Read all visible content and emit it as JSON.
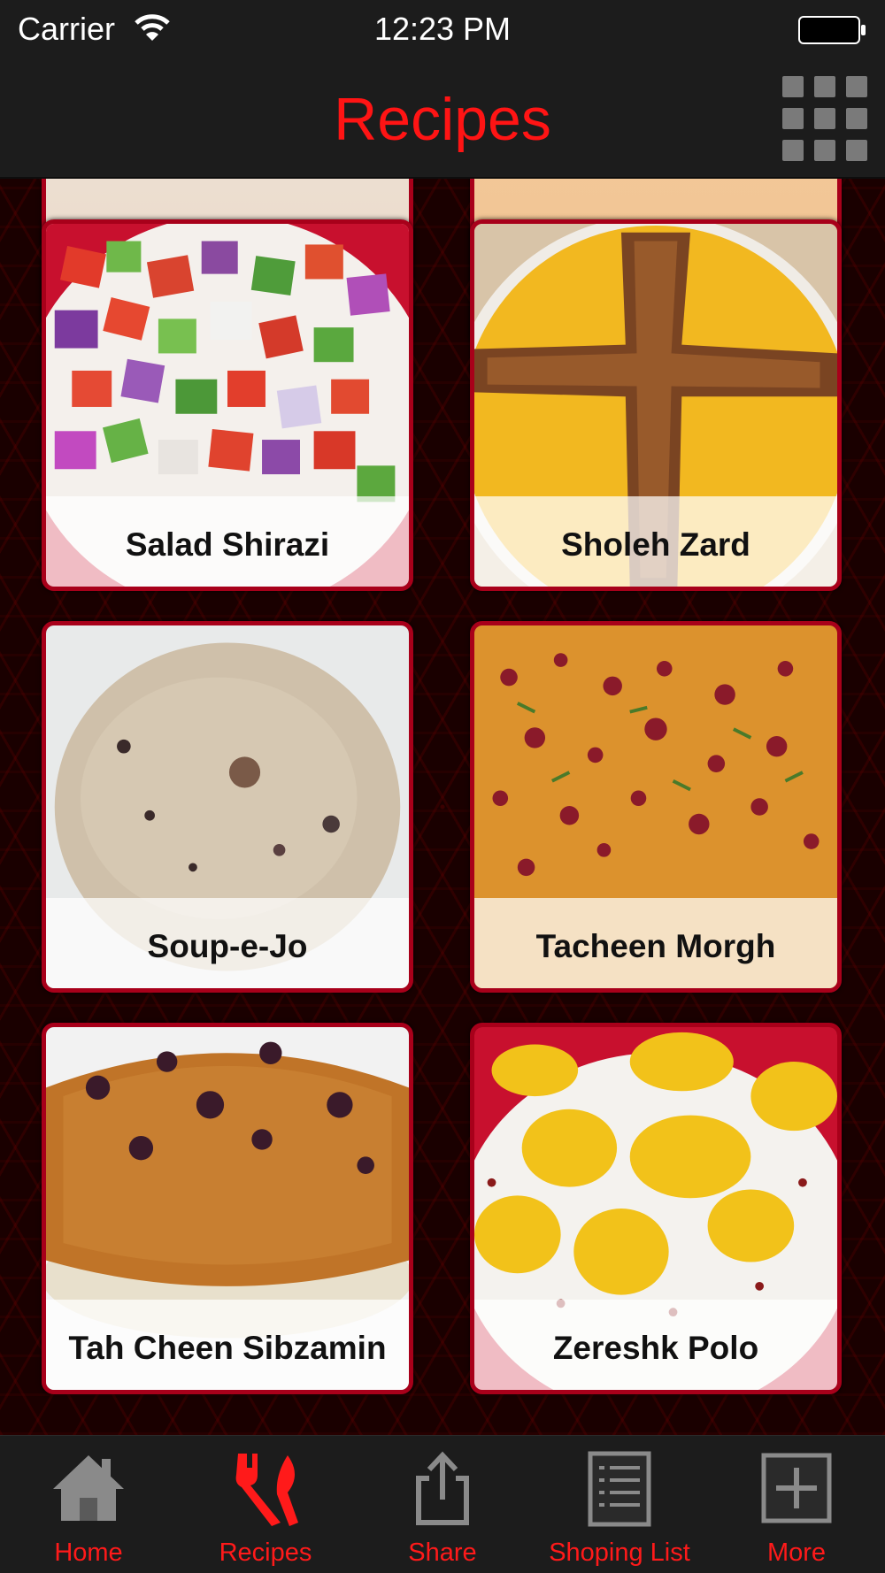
{
  "status_bar": {
    "carrier": "Carrier",
    "time": "12:23 PM"
  },
  "nav_bar": {
    "title": "Recipes"
  },
  "recipes": [
    {
      "name": "Salad Shirazi"
    },
    {
      "name": "Sholeh Zard"
    },
    {
      "name": "Soup-e-Jo"
    },
    {
      "name": "Tacheen Morgh"
    },
    {
      "name": "Tah Cheen Sibzamin"
    },
    {
      "name": "Zereshk Polo"
    }
  ],
  "tab_bar": {
    "tabs": [
      {
        "label": "Home",
        "icon": "home-icon",
        "selected": false
      },
      {
        "label": "Recipes",
        "icon": "fork-knife-icon",
        "selected": true
      },
      {
        "label": "Share",
        "icon": "share-icon",
        "selected": false
      },
      {
        "label": "Shoping List",
        "icon": "list-icon",
        "selected": false
      },
      {
        "label": "More",
        "icon": "plus-icon",
        "selected": false
      }
    ]
  },
  "colors": {
    "accent": "#ff1414",
    "card_border": "#a8001a",
    "bar_bg": "#1c1c1c"
  }
}
